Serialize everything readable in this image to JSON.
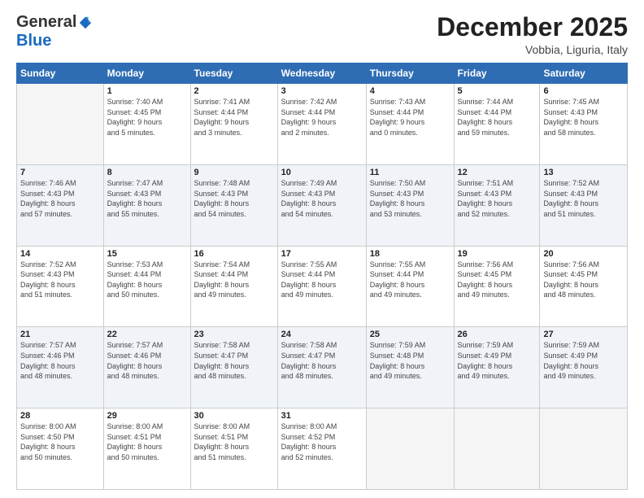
{
  "header": {
    "logo_general": "General",
    "logo_blue": "Blue",
    "month_title": "December 2025",
    "location": "Vobbia, Liguria, Italy"
  },
  "days_of_week": [
    "Sunday",
    "Monday",
    "Tuesday",
    "Wednesday",
    "Thursday",
    "Friday",
    "Saturday"
  ],
  "weeks": [
    [
      {
        "num": "",
        "info": ""
      },
      {
        "num": "1",
        "info": "Sunrise: 7:40 AM\nSunset: 4:45 PM\nDaylight: 9 hours\nand 5 minutes."
      },
      {
        "num": "2",
        "info": "Sunrise: 7:41 AM\nSunset: 4:44 PM\nDaylight: 9 hours\nand 3 minutes."
      },
      {
        "num": "3",
        "info": "Sunrise: 7:42 AM\nSunset: 4:44 PM\nDaylight: 9 hours\nand 2 minutes."
      },
      {
        "num": "4",
        "info": "Sunrise: 7:43 AM\nSunset: 4:44 PM\nDaylight: 9 hours\nand 0 minutes."
      },
      {
        "num": "5",
        "info": "Sunrise: 7:44 AM\nSunset: 4:44 PM\nDaylight: 8 hours\nand 59 minutes."
      },
      {
        "num": "6",
        "info": "Sunrise: 7:45 AM\nSunset: 4:43 PM\nDaylight: 8 hours\nand 58 minutes."
      }
    ],
    [
      {
        "num": "7",
        "info": "Sunrise: 7:46 AM\nSunset: 4:43 PM\nDaylight: 8 hours\nand 57 minutes."
      },
      {
        "num": "8",
        "info": "Sunrise: 7:47 AM\nSunset: 4:43 PM\nDaylight: 8 hours\nand 55 minutes."
      },
      {
        "num": "9",
        "info": "Sunrise: 7:48 AM\nSunset: 4:43 PM\nDaylight: 8 hours\nand 54 minutes."
      },
      {
        "num": "10",
        "info": "Sunrise: 7:49 AM\nSunset: 4:43 PM\nDaylight: 8 hours\nand 54 minutes."
      },
      {
        "num": "11",
        "info": "Sunrise: 7:50 AM\nSunset: 4:43 PM\nDaylight: 8 hours\nand 53 minutes."
      },
      {
        "num": "12",
        "info": "Sunrise: 7:51 AM\nSunset: 4:43 PM\nDaylight: 8 hours\nand 52 minutes."
      },
      {
        "num": "13",
        "info": "Sunrise: 7:52 AM\nSunset: 4:43 PM\nDaylight: 8 hours\nand 51 minutes."
      }
    ],
    [
      {
        "num": "14",
        "info": "Sunrise: 7:52 AM\nSunset: 4:43 PM\nDaylight: 8 hours\nand 51 minutes."
      },
      {
        "num": "15",
        "info": "Sunrise: 7:53 AM\nSunset: 4:44 PM\nDaylight: 8 hours\nand 50 minutes."
      },
      {
        "num": "16",
        "info": "Sunrise: 7:54 AM\nSunset: 4:44 PM\nDaylight: 8 hours\nand 49 minutes."
      },
      {
        "num": "17",
        "info": "Sunrise: 7:55 AM\nSunset: 4:44 PM\nDaylight: 8 hours\nand 49 minutes."
      },
      {
        "num": "18",
        "info": "Sunrise: 7:55 AM\nSunset: 4:44 PM\nDaylight: 8 hours\nand 49 minutes."
      },
      {
        "num": "19",
        "info": "Sunrise: 7:56 AM\nSunset: 4:45 PM\nDaylight: 8 hours\nand 49 minutes."
      },
      {
        "num": "20",
        "info": "Sunrise: 7:56 AM\nSunset: 4:45 PM\nDaylight: 8 hours\nand 48 minutes."
      }
    ],
    [
      {
        "num": "21",
        "info": "Sunrise: 7:57 AM\nSunset: 4:46 PM\nDaylight: 8 hours\nand 48 minutes."
      },
      {
        "num": "22",
        "info": "Sunrise: 7:57 AM\nSunset: 4:46 PM\nDaylight: 8 hours\nand 48 minutes."
      },
      {
        "num": "23",
        "info": "Sunrise: 7:58 AM\nSunset: 4:47 PM\nDaylight: 8 hours\nand 48 minutes."
      },
      {
        "num": "24",
        "info": "Sunrise: 7:58 AM\nSunset: 4:47 PM\nDaylight: 8 hours\nand 48 minutes."
      },
      {
        "num": "25",
        "info": "Sunrise: 7:59 AM\nSunset: 4:48 PM\nDaylight: 8 hours\nand 49 minutes."
      },
      {
        "num": "26",
        "info": "Sunrise: 7:59 AM\nSunset: 4:49 PM\nDaylight: 8 hours\nand 49 minutes."
      },
      {
        "num": "27",
        "info": "Sunrise: 7:59 AM\nSunset: 4:49 PM\nDaylight: 8 hours\nand 49 minutes."
      }
    ],
    [
      {
        "num": "28",
        "info": "Sunrise: 8:00 AM\nSunset: 4:50 PM\nDaylight: 8 hours\nand 50 minutes."
      },
      {
        "num": "29",
        "info": "Sunrise: 8:00 AM\nSunset: 4:51 PM\nDaylight: 8 hours\nand 50 minutes."
      },
      {
        "num": "30",
        "info": "Sunrise: 8:00 AM\nSunset: 4:51 PM\nDaylight: 8 hours\nand 51 minutes."
      },
      {
        "num": "31",
        "info": "Sunrise: 8:00 AM\nSunset: 4:52 PM\nDaylight: 8 hours\nand 52 minutes."
      },
      {
        "num": "",
        "info": ""
      },
      {
        "num": "",
        "info": ""
      },
      {
        "num": "",
        "info": ""
      }
    ]
  ]
}
